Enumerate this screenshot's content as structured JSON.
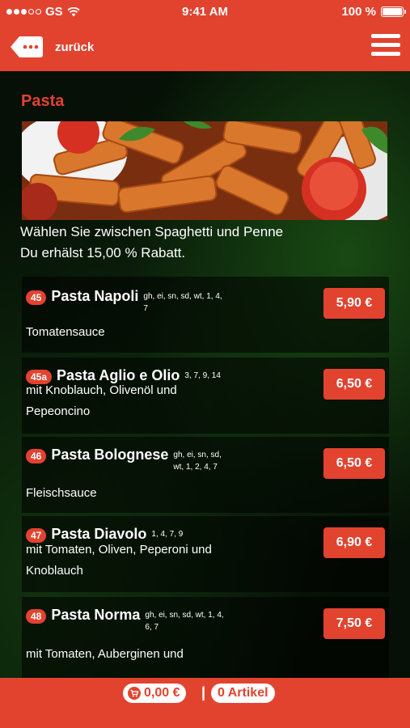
{
  "status_bar": {
    "carrier": "GS",
    "time": "9:41 AM",
    "battery": "100 %"
  },
  "nav": {
    "back_label": "zurück",
    "back_icon": "speech-bubble-back-icon",
    "menu_icon": "hamburger-menu-icon"
  },
  "section": {
    "title": "Pasta",
    "intro_line1": "Wählen Sie zwischen Spaghetti und Penne",
    "intro_line2": "Du erhälst 15,00 % Rabatt."
  },
  "items": [
    {
      "num": "45",
      "name": "Pasta Napoli",
      "allergens": "gh, ei, sn, sd, wt, 1, 4,",
      "allergens2": "7",
      "desc1": "Tomatensauce",
      "desc2": "",
      "price": "5,90 €"
    },
    {
      "num": "45a",
      "name": "Pasta Aglio e Olio",
      "allergens": "3, 7, 9, 14",
      "allergens2": "",
      "desc1": "mit Knoblauch, Olivenöl und",
      "desc2": "Pepeoncino",
      "price": "6,50 €"
    },
    {
      "num": "46",
      "name": "Pasta Bolognese",
      "allergens": "gh, ei, sn, sd,",
      "allergens2": "wt, 1, 2, 4, 7",
      "desc1": "Fleischsauce",
      "desc2": "",
      "price": "6,50 €"
    },
    {
      "num": "47",
      "name": "Pasta Diavolo",
      "allergens": "1, 4, 7, 9",
      "allergens2": "",
      "desc1": "mit Tomaten, Oliven, Peperoni und",
      "desc2": "Knoblauch",
      "price": "6,90 €"
    },
    {
      "num": "48",
      "name": "Pasta Norma",
      "allergens": "gh, ei, sn, sd, wt, 1, 4,",
      "allergens2": "6, 7",
      "desc1": "mit Tomaten, Auberginen und",
      "desc2": "",
      "price": "7,50 €"
    }
  ],
  "cart": {
    "total": "0,00 €",
    "separator": "|",
    "count": "0 Artikel",
    "icon": "shopping-cart-icon"
  },
  "colors": {
    "accent": "#e2432f",
    "background": "#061006"
  }
}
